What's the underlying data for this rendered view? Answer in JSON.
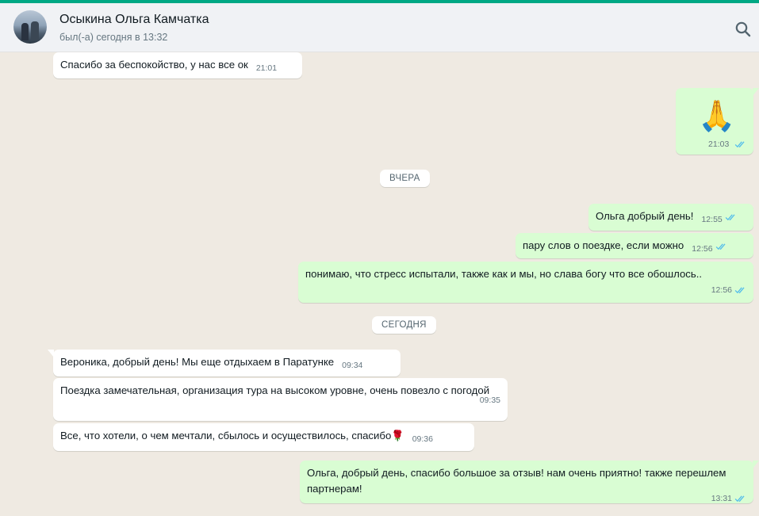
{
  "header": {
    "contact_name": "Осыкина Ольга Камчатка",
    "status": "был(-а) сегодня в 13:32"
  },
  "icons": {
    "search": "search-icon",
    "read_receipt": "double-check-icon",
    "rose": "rose-emoji",
    "praying_hands": "praying-hands-emoji"
  },
  "colors": {
    "incoming": "#ffffff",
    "outgoing": "#d9fdd3",
    "background": "#efeae2",
    "accent": "#00a884",
    "tick": "#53bdeb"
  },
  "messages": [
    {
      "dir": "in",
      "text": "Спасибо за беспокойство, у нас все ок",
      "time": "21:01"
    },
    {
      "dir": "out",
      "text": "🙏",
      "time": "21:03"
    },
    {
      "dir": "out",
      "text": "Ольга добрый день!",
      "time": "12:55"
    },
    {
      "dir": "out",
      "text": "пару слов о поездке, если можно",
      "time": "12:56"
    },
    {
      "dir": "out",
      "text": "понимаю, что стресс испытали, также как и мы, но слава богу что все обошлось..",
      "time": "12:56"
    },
    {
      "dir": "in",
      "text": "Вероника, добрый день! Мы еще отдыхаем в Паратунке",
      "time": "09:34"
    },
    {
      "dir": "in",
      "text": "Поездка замечательная, организация тура на высоком уровне, очень повезло с погодой",
      "time": "09:35"
    },
    {
      "dir": "in",
      "text": "Все, что хотели, о чем мечтали, сбылось и осуществилось, спасибо🌹",
      "time": "09:36"
    },
    {
      "dir": "out",
      "text": "Ольга, добрый день, спасибо большое за отзыв! нам очень приятно! также перешлем партнерам!",
      "time": "13:31"
    }
  ],
  "dividers": {
    "yesterday": "ВЧЕРА",
    "today": "СЕГОДНЯ"
  }
}
